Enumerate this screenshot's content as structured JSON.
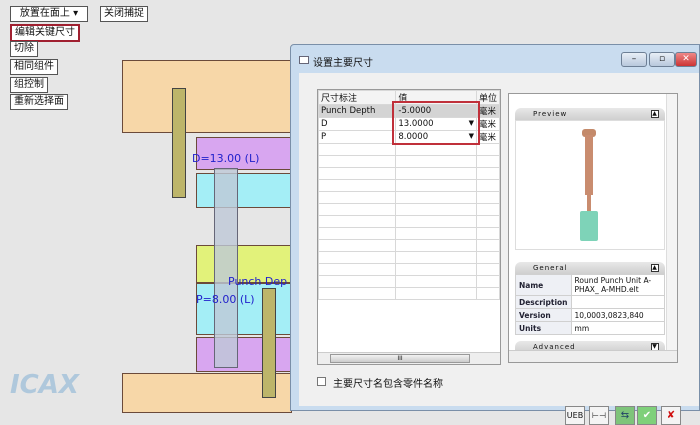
{
  "toolbar": {
    "place_on_face": "放置在面上",
    "close_capture": "关闭捕捉",
    "edit_key_dims": "编辑关键尺寸",
    "cut": "切除",
    "same_component": "相同组件",
    "group_control": "组控制",
    "reselect_face": "重新选择面"
  },
  "cad": {
    "dim_d": "D=13.00 (L)",
    "dim_punch": "Punch Dep",
    "dim_p": "P=8.00 (L)"
  },
  "dialog": {
    "title": "设置主要尺寸",
    "columns": [
      "尺寸标注",
      "值",
      "单位"
    ],
    "rows": [
      {
        "name": "Punch Depth",
        "value": "-5.0000",
        "unit": "毫米"
      },
      {
        "name": "D",
        "value": "13.0000",
        "unit": "毫米"
      },
      {
        "name": "P",
        "value": "8.0000",
        "unit": "毫米"
      }
    ],
    "preview_label": "Preview",
    "general_label": "General",
    "general": [
      {
        "key": "Name",
        "value": "Round Punch Unit A-PHAX_ A-MHD.elt"
      },
      {
        "key": "Description",
        "value": ""
      },
      {
        "key": "Version",
        "value": "10,0003,0823,840"
      },
      {
        "key": "Units",
        "value": "mm"
      }
    ],
    "advanced_label": "Advanced",
    "checkbox_label": "主要尺寸名包含零件名称",
    "checkbox_checked": false,
    "ueb_label": "UEB",
    "scroll_thumb": "III"
  },
  "watermark": "ICAX"
}
